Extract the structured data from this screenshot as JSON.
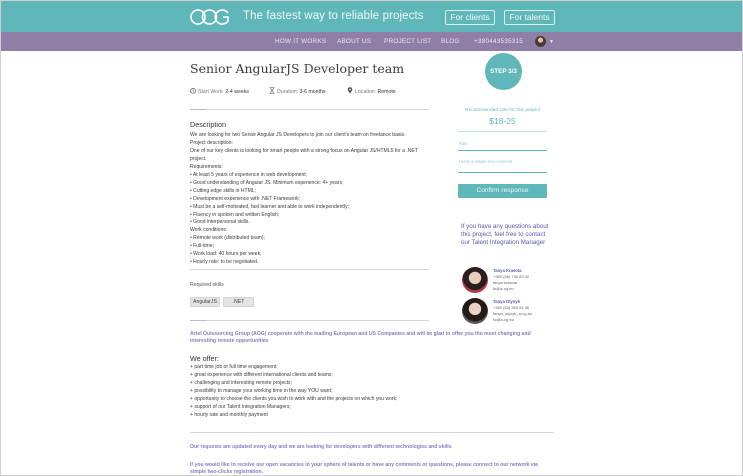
{
  "header": {
    "logo_text": "AOG",
    "tagline": "The fastest way to reliable projects",
    "for_clients": "For clients",
    "for_talents": "For talents"
  },
  "nav": {
    "items": [
      "HOW IT WORKS",
      "ABOUT US",
      "PROJECT LIST",
      "BLOG",
      "+380443535315"
    ]
  },
  "job": {
    "title": "Senior AngularJS Developer team",
    "start_work_label": "Start Work:",
    "start_work_value": "2-4 weeks",
    "duration_label": "Duration:",
    "duration_value": "3-6 months",
    "location_label": "Location:",
    "location_value": "Remote",
    "description_heading": "Description",
    "description_lines": [
      "We are looking for two Senior Angular JS Developers to join our client's team on freelance basis.",
      "Project description:",
      "One of our key clients is looking for smart people with a strong focus on Angular JS/HTML5 for a .NET",
      "project.",
      "Requirements:",
      "• At least 5 years of experience in web development;",
      "• Good understanding of Angular JS. Minimum experience: 4+ years;",
      "• Cutting edge skills in HTML;",
      "• Development experience with .NET Framework;",
      "• Must be a self-motivated, fast learner and able to work independently;",
      "• Fluency in spoken and written English;",
      "• Good interpersonal skills.",
      "Work conditions:",
      "• Remote work (distributed team);",
      "• Full-time;",
      "• Work load: 40 hours per week;",
      "• Hourly rate: to be negotiated."
    ],
    "required_skills_label": "Required skills",
    "skills": [
      "AngularJS",
      ".NET"
    ]
  },
  "about": {
    "text": "Artel Outsourcing Group (AOG) cooperate with the leading European and US Companies and will be glad to offer you the most changing and interesting remote opportunities",
    "offer_heading": "We offer:",
    "offer_items": [
      "+ part time job or full time engagement;",
      "+ great experience with different international clients and teams;",
      "+ challenging and interesting remote projects;",
      "+ possibility to manage your working time in the way YOU want;",
      "+ opportunity to choose the clients you wish to work with and the projects on which you work;",
      "+ support of our Talent Integration Managers;",
      "+ hourly rate and monthly payment"
    ],
    "footer_note_1": "Our requests are updated every day and we are looking for developers with different technologies and skills",
    "footer_note_2": "If you would like to receive our open vacancies in your sphere of talents or have any comments or questions, please connect to our network via simple two-clicks registration."
  },
  "sidebar": {
    "step": "STEP 3/3",
    "rate_label": "Recommended rate for this project",
    "rate_value": "$18-25",
    "rate_placeholder": "Rate",
    "comment_placeholder": "Leave a simple text comment",
    "confirm_label": "Confirm response",
    "help_text": "If you have any questions about this project, feel free to contact our Talent Integration Manager",
    "managers": [
      {
        "name": "Tanya Krasota",
        "phone": "+380 (68) 736 83 42",
        "skype": "tanya.krasota",
        "email": "tk@a-og.eu"
      },
      {
        "name": "Tanya Olynyk",
        "phone": "+380 (63) 363 51 36",
        "skype": "tanya_olynyk_a-og.eu",
        "email": "to@a-og.eu"
      }
    ]
  },
  "colors": {
    "teal": "#5fb7b9",
    "purple_nav": "#8f7fa6",
    "link_purple": "#5a5aa8"
  }
}
